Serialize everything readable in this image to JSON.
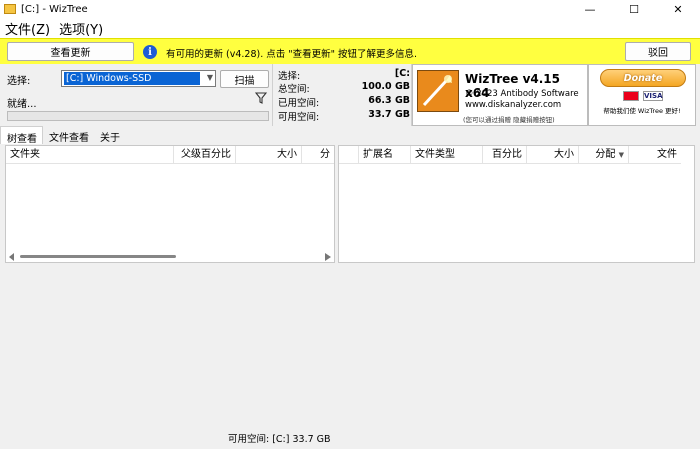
{
  "window": {
    "title": "[C:]  - WizTree",
    "minimize": "—",
    "maximize": "☐",
    "close": "✕"
  },
  "menu": [
    "文件(Z)",
    "选项(Y)"
  ],
  "notification": {
    "view_update_label": "查看更新",
    "message": "有可用的更新 (v4.28). 点击 \"查看更新\" 按钮了解更多信息.",
    "dismiss_label": "驳回"
  },
  "scan": {
    "select_label": "选择:",
    "drive_value": "[C:] Windows-SSD",
    "scan_label": "扫描",
    "status": "就绪..."
  },
  "stats": {
    "select_label": "选择:",
    "select_value": "[C:",
    "total_label": "总空间:",
    "total_value": "100.0 GB",
    "used_label": "已用空间:",
    "used_value": "66.3 GB",
    "free_label": "可用空间:",
    "free_value": "33.7 GB"
  },
  "brand": {
    "name": "WizTree v4.15 x64",
    "copyright": "© 2023 Antibody Software",
    "website": "www.diskanalyzer.com",
    "note": "(您可以通过捐赠 隐藏捐赠按钮)"
  },
  "donate": {
    "label": "Donate",
    "visa": "VISA",
    "caption": "帮助我们使 WizTree 更好!"
  },
  "tabs": [
    "树查看",
    "文件查看",
    "关于"
  ],
  "tree_columns": [
    "文件夹",
    "父级百分比",
    "大小",
    "分"
  ],
  "ext_columns": [
    "扩展名",
    "文件类型",
    "百分比",
    "大小",
    "分配",
    "文件"
  ],
  "statusbar": "可用空间: [C:] 33.7 GB"
}
